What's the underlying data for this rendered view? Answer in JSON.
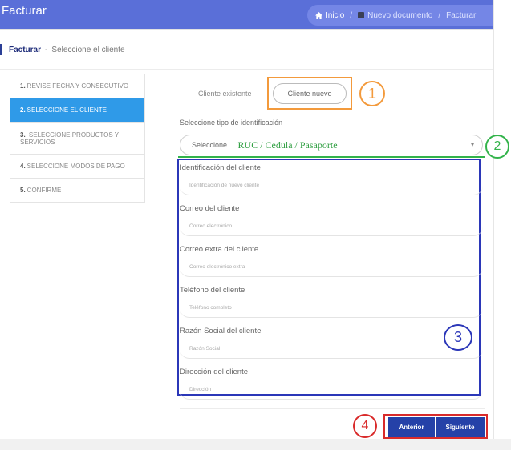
{
  "header": {
    "title": "Facturar",
    "breadcrumb": [
      "Inicio",
      "Nuevo documento",
      "Facturar"
    ]
  },
  "subheader": {
    "bold": "Facturar",
    "dash": "-",
    "text": "Seleccione el cliente"
  },
  "steps": [
    {
      "num": "1.",
      "label": "REVISE FECHA Y CONSECUTIVO",
      "active": false
    },
    {
      "num": "2.",
      "label": "SELECCIONE EL CLIENTE",
      "active": true
    },
    {
      "num": "3.",
      "label": "SELECCIONE PRODUCTOS Y SERVICIOS",
      "active": false
    },
    {
      "num": "4.",
      "label": "SELECCIONE MODOS DE PAGO",
      "active": false
    },
    {
      "num": "5.",
      "label": "CONFIRME",
      "active": false
    }
  ],
  "client": {
    "existing": "Cliente existente",
    "new": "Cliente nuevo"
  },
  "id_type": {
    "label": "Seleccione tipo de identificación",
    "placeholder": "Seleccione...",
    "hint": "RUC / Cedula / Pasaporte"
  },
  "fields": [
    {
      "label": "Identificación del cliente",
      "placeholder": "Identificación de nuevo cliente"
    },
    {
      "label": "Correo del cliente",
      "placeholder": "Correo electrónico"
    },
    {
      "label": "Correo extra del cliente",
      "placeholder": "Correo electrónico extra"
    },
    {
      "label": "Teléfono del cliente",
      "placeholder": "Teléfono completo"
    },
    {
      "label": "Razón Social del cliente",
      "placeholder": "Razón Social"
    },
    {
      "label": "Dirección del cliente",
      "placeholder": "Dirección"
    }
  ],
  "annotations": [
    "1",
    "2",
    "3",
    "4"
  ],
  "buttons": {
    "prev": "Anterior",
    "next": "Siguiente"
  },
  "colors": {
    "header": "#5a6fd8",
    "active_step": "#2f9ae8",
    "button": "#2541a8",
    "annotation_1": "#f39a3c",
    "annotation_2": "#32b34a",
    "annotation_3": "#2b37b8",
    "annotation_4": "#d92b2b"
  }
}
